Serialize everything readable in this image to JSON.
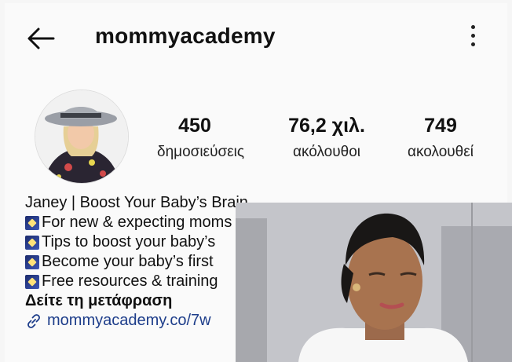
{
  "header": {
    "username": "mommyacademy"
  },
  "stats": [
    {
      "value": "450",
      "label": "δημοσιεύσεις"
    },
    {
      "value": "76,2 χιλ.",
      "label": "ακόλουθοι"
    },
    {
      "value": "749",
      "label": "ακολουθεί"
    }
  ],
  "bio": {
    "name": "Janey | Boost Your Baby’s Brain",
    "lines": [
      "For new & expecting moms",
      "Tips to boost your baby’s",
      "Become your baby’s first",
      "Free resources & training"
    ],
    "translate": "Δείτε τη μετάφραση",
    "link": "mommyacademy.co/7w"
  },
  "icons": {
    "back": "back-arrow-icon",
    "more": "more-options-icon",
    "sparkle": "sparkles-icon",
    "link": "link-icon"
  }
}
